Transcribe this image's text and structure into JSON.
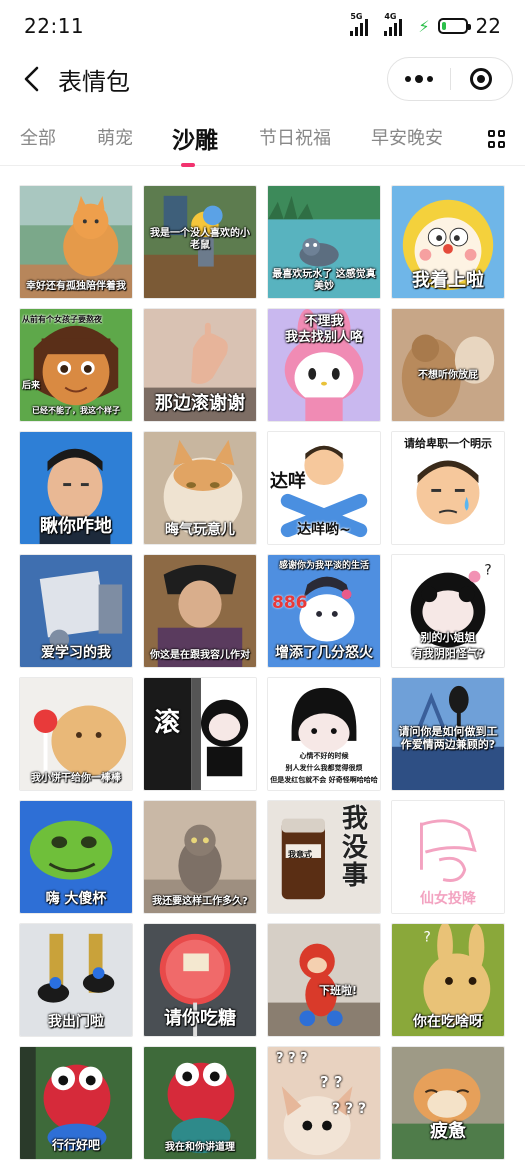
{
  "status_bar": {
    "time": "22:11",
    "network_1": "5G",
    "network_2": "4G",
    "battery_level": "22",
    "battery_fraction": 0.22
  },
  "header": {
    "title": "表情包"
  },
  "tabs": [
    {
      "label": "全部",
      "active": false
    },
    {
      "label": "萌宠",
      "active": false
    },
    {
      "label": "沙雕",
      "active": true
    },
    {
      "label": "节日祝福",
      "active": false
    },
    {
      "label": "早安晚安",
      "active": false
    }
  ],
  "accent_color": "#f2336f",
  "stickers": [
    {
      "captions": [
        "幸好还有孤独陪伴着我"
      ]
    },
    {
      "captions": [
        "我是一个没人喜欢的小老鼠"
      ]
    },
    {
      "captions": [
        "最喜欢玩水了 这感觉真美妙"
      ]
    },
    {
      "captions": [
        "我着上啦"
      ]
    },
    {
      "captions": [
        "从前有个女孩子要熬夜",
        "后来",
        "已经不能了，我这个样子"
      ]
    },
    {
      "captions": [
        "那边滚谢谢"
      ]
    },
    {
      "captions": [
        "不理我",
        "我去找别人咯"
      ]
    },
    {
      "captions": [
        "不想听你放屁"
      ]
    },
    {
      "captions": [
        "瞅你咋地"
      ]
    },
    {
      "captions": [
        "晦气玩意儿"
      ]
    },
    {
      "captions": [
        "达咩",
        "达咩哟~"
      ]
    },
    {
      "captions": [
        "请给卑职一个明示"
      ]
    },
    {
      "captions": [
        "爱学习的我"
      ]
    },
    {
      "captions": [
        "你这是在跟我容儿作对"
      ]
    },
    {
      "captions": [
        "感谢你为我平淡的生活",
        "886",
        "增添了几分怒火"
      ]
    },
    {
      "captions": [
        "别的小姐姐",
        "有我阴阳怪气?"
      ]
    },
    {
      "captions": [
        "我小饼干给你一棒棒"
      ]
    },
    {
      "captions": [
        "滚"
      ]
    },
    {
      "captions": [
        "心情不好的时候",
        "别人发什么我都觉得很烦",
        "但是发红包就不会 好奇怪啊哈哈哈"
      ]
    },
    {
      "captions": [
        "请问你是如何做到工作爱情两边兼顾的?"
      ]
    },
    {
      "captions": [
        "嗨 大傻杯"
      ]
    },
    {
      "captions": [
        "我还要这样工作多久?"
      ]
    },
    {
      "captions": [
        "我没事",
        "我竟式"
      ]
    },
    {
      "captions": [
        "仙女投降"
      ]
    },
    {
      "captions": [
        "我出门啦"
      ]
    },
    {
      "captions": [
        "请你吃糖"
      ]
    },
    {
      "captions": [
        "下班啦!"
      ]
    },
    {
      "captions": [
        "你在吃啥呀"
      ]
    },
    {
      "captions": [
        "行行好吧"
      ]
    },
    {
      "captions": [
        "我在和你讲道理"
      ]
    },
    {
      "captions": [
        "? ? ?",
        "? ?",
        "? ? ?"
      ]
    },
    {
      "captions": [
        "疲惫"
      ]
    }
  ]
}
